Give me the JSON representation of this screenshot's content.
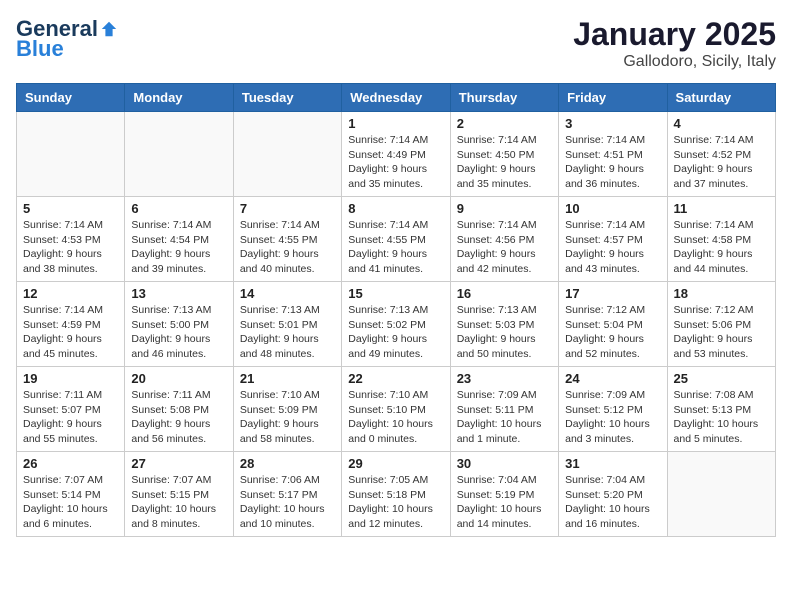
{
  "header": {
    "logo_general": "General",
    "logo_blue": "Blue",
    "month_title": "January 2025",
    "location": "Gallodoro, Sicily, Italy"
  },
  "weekdays": [
    "Sunday",
    "Monday",
    "Tuesday",
    "Wednesday",
    "Thursday",
    "Friday",
    "Saturday"
  ],
  "weeks": [
    [
      {
        "day": "",
        "content": ""
      },
      {
        "day": "",
        "content": ""
      },
      {
        "day": "",
        "content": ""
      },
      {
        "day": "1",
        "content": "Sunrise: 7:14 AM\nSunset: 4:49 PM\nDaylight: 9 hours and 35 minutes."
      },
      {
        "day": "2",
        "content": "Sunrise: 7:14 AM\nSunset: 4:50 PM\nDaylight: 9 hours and 35 minutes."
      },
      {
        "day": "3",
        "content": "Sunrise: 7:14 AM\nSunset: 4:51 PM\nDaylight: 9 hours and 36 minutes."
      },
      {
        "day": "4",
        "content": "Sunrise: 7:14 AM\nSunset: 4:52 PM\nDaylight: 9 hours and 37 minutes."
      }
    ],
    [
      {
        "day": "5",
        "content": "Sunrise: 7:14 AM\nSunset: 4:53 PM\nDaylight: 9 hours and 38 minutes."
      },
      {
        "day": "6",
        "content": "Sunrise: 7:14 AM\nSunset: 4:54 PM\nDaylight: 9 hours and 39 minutes."
      },
      {
        "day": "7",
        "content": "Sunrise: 7:14 AM\nSunset: 4:55 PM\nDaylight: 9 hours and 40 minutes."
      },
      {
        "day": "8",
        "content": "Sunrise: 7:14 AM\nSunset: 4:55 PM\nDaylight: 9 hours and 41 minutes."
      },
      {
        "day": "9",
        "content": "Sunrise: 7:14 AM\nSunset: 4:56 PM\nDaylight: 9 hours and 42 minutes."
      },
      {
        "day": "10",
        "content": "Sunrise: 7:14 AM\nSunset: 4:57 PM\nDaylight: 9 hours and 43 minutes."
      },
      {
        "day": "11",
        "content": "Sunrise: 7:14 AM\nSunset: 4:58 PM\nDaylight: 9 hours and 44 minutes."
      }
    ],
    [
      {
        "day": "12",
        "content": "Sunrise: 7:14 AM\nSunset: 4:59 PM\nDaylight: 9 hours and 45 minutes."
      },
      {
        "day": "13",
        "content": "Sunrise: 7:13 AM\nSunset: 5:00 PM\nDaylight: 9 hours and 46 minutes."
      },
      {
        "day": "14",
        "content": "Sunrise: 7:13 AM\nSunset: 5:01 PM\nDaylight: 9 hours and 48 minutes."
      },
      {
        "day": "15",
        "content": "Sunrise: 7:13 AM\nSunset: 5:02 PM\nDaylight: 9 hours and 49 minutes."
      },
      {
        "day": "16",
        "content": "Sunrise: 7:13 AM\nSunset: 5:03 PM\nDaylight: 9 hours and 50 minutes."
      },
      {
        "day": "17",
        "content": "Sunrise: 7:12 AM\nSunset: 5:04 PM\nDaylight: 9 hours and 52 minutes."
      },
      {
        "day": "18",
        "content": "Sunrise: 7:12 AM\nSunset: 5:06 PM\nDaylight: 9 hours and 53 minutes."
      }
    ],
    [
      {
        "day": "19",
        "content": "Sunrise: 7:11 AM\nSunset: 5:07 PM\nDaylight: 9 hours and 55 minutes."
      },
      {
        "day": "20",
        "content": "Sunrise: 7:11 AM\nSunset: 5:08 PM\nDaylight: 9 hours and 56 minutes."
      },
      {
        "day": "21",
        "content": "Sunrise: 7:10 AM\nSunset: 5:09 PM\nDaylight: 9 hours and 58 minutes."
      },
      {
        "day": "22",
        "content": "Sunrise: 7:10 AM\nSunset: 5:10 PM\nDaylight: 10 hours and 0 minutes."
      },
      {
        "day": "23",
        "content": "Sunrise: 7:09 AM\nSunset: 5:11 PM\nDaylight: 10 hours and 1 minute."
      },
      {
        "day": "24",
        "content": "Sunrise: 7:09 AM\nSunset: 5:12 PM\nDaylight: 10 hours and 3 minutes."
      },
      {
        "day": "25",
        "content": "Sunrise: 7:08 AM\nSunset: 5:13 PM\nDaylight: 10 hours and 5 minutes."
      }
    ],
    [
      {
        "day": "26",
        "content": "Sunrise: 7:07 AM\nSunset: 5:14 PM\nDaylight: 10 hours and 6 minutes."
      },
      {
        "day": "27",
        "content": "Sunrise: 7:07 AM\nSunset: 5:15 PM\nDaylight: 10 hours and 8 minutes."
      },
      {
        "day": "28",
        "content": "Sunrise: 7:06 AM\nSunset: 5:17 PM\nDaylight: 10 hours and 10 minutes."
      },
      {
        "day": "29",
        "content": "Sunrise: 7:05 AM\nSunset: 5:18 PM\nDaylight: 10 hours and 12 minutes."
      },
      {
        "day": "30",
        "content": "Sunrise: 7:04 AM\nSunset: 5:19 PM\nDaylight: 10 hours and 14 minutes."
      },
      {
        "day": "31",
        "content": "Sunrise: 7:04 AM\nSunset: 5:20 PM\nDaylight: 10 hours and 16 minutes."
      },
      {
        "day": "",
        "content": ""
      }
    ]
  ]
}
